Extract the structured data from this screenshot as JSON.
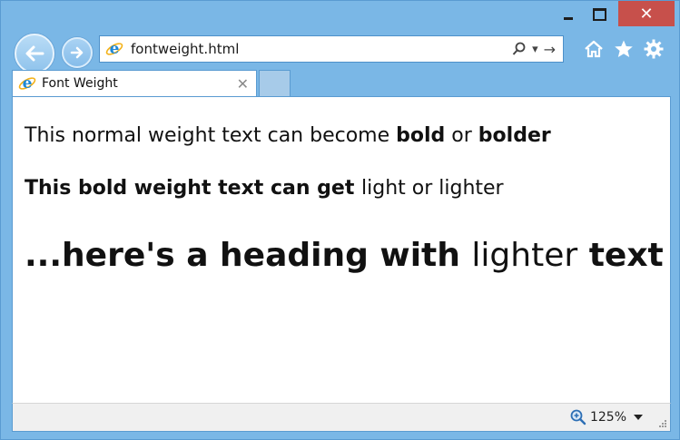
{
  "window": {
    "minimize_symbol": "–",
    "maximize_symbol": "□",
    "close_symbol": "✕"
  },
  "toolbar": {
    "address_value": "fontweight.html",
    "search_symbol": "⌕",
    "dropdown_symbol": "▾",
    "go_symbol": "→"
  },
  "tab": {
    "title": "Font Weight",
    "close_symbol": "✕"
  },
  "content": {
    "line1_normal": "This normal weight text can become ",
    "line1_bold": "bold",
    "line1_mid": " or ",
    "line1_bolder": "bolder",
    "line2_bold": "This bold weight text can get ",
    "line2_light": "light or lighter",
    "line3_bold": "...here's a heading with ",
    "line3_lighter": "lighter",
    "line3_space": " ",
    "line3_text": "text"
  },
  "status": {
    "zoom_level": "125%"
  },
  "colors": {
    "frame": "#7ab7e6",
    "close_button": "#c7504b",
    "ie_blue": "#1e88d6",
    "ie_gold": "#f3b21b"
  },
  "icons": [
    "back-arrow-icon",
    "forward-arrow-icon",
    "ie-logo-icon",
    "search-icon",
    "home-icon",
    "favorites-star-icon",
    "settings-gear-icon",
    "zoom-icon",
    "resize-grip-icon"
  ]
}
